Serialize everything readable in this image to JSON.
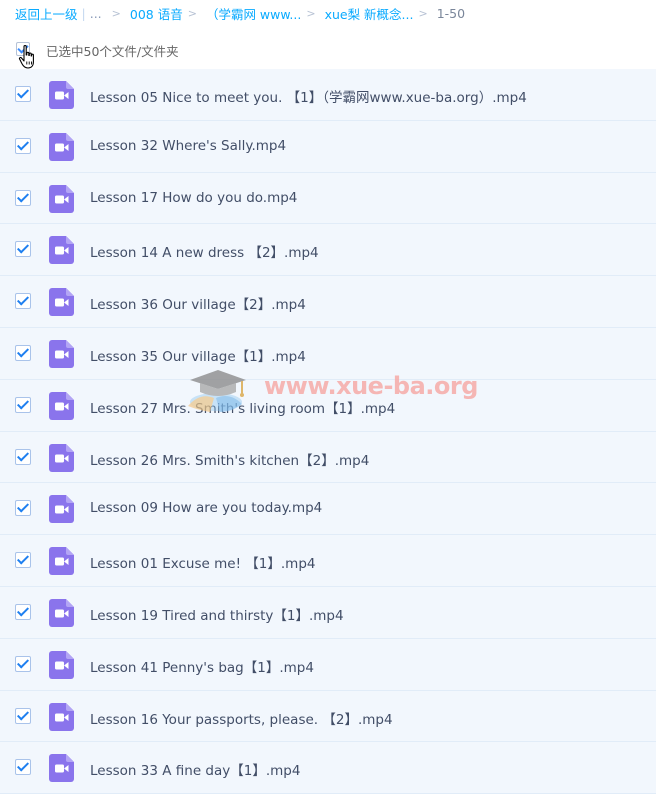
{
  "breadcrumb": {
    "back": "返回上一级",
    "separator": "|",
    "ellipsis": "...",
    "items": [
      "008 语音",
      "（学霸网 www...",
      "xue梨 新概念..."
    ],
    "arrow": ">",
    "current": "1-50"
  },
  "selection": {
    "label": "已选中50个文件/文件夹"
  },
  "files": [
    {
      "name": "Lesson 05 Nice to meet you. 【1】（学霸网www.xue-ba.org）.mp4"
    },
    {
      "name": "Lesson 32 Where's Sally.mp4"
    },
    {
      "name": "Lesson 17 How do you do.mp4"
    },
    {
      "name": "Lesson 14 A new dress 【2】.mp4"
    },
    {
      "name": "Lesson 36 Our village【2】.mp4"
    },
    {
      "name": "Lesson 35 Our village【1】.mp4"
    },
    {
      "name": "Lesson 27 Mrs. Smith's living room【1】.mp4"
    },
    {
      "name": "Lesson 26 Mrs. Smith's kitchen【2】.mp4"
    },
    {
      "name": "Lesson 09 How are you today.mp4"
    },
    {
      "name": "Lesson 01 Excuse me! 【1】.mp4"
    },
    {
      "name": "Lesson 19 Tired and thirsty【1】.mp4"
    },
    {
      "name": "Lesson 41 Penny's bag【1】.mp4"
    },
    {
      "name": "Lesson 16 Your passports, please. 【2】.mp4"
    },
    {
      "name": "Lesson 33 A fine day【1】.mp4"
    }
  ],
  "watermark": {
    "text": "www.xue-ba.org"
  },
  "colors": {
    "link": "#09aaff",
    "row_bg": "#f2f7fd",
    "check": "#1e7ff0",
    "video_icon": "#8a74ec",
    "watermark": "#f7a5a0"
  }
}
